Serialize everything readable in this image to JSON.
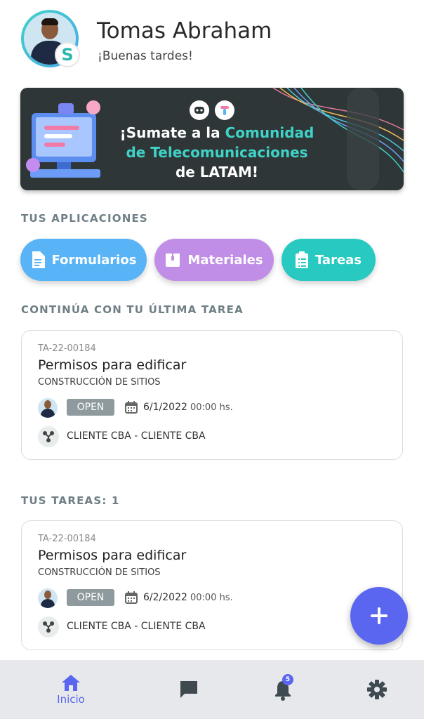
{
  "header": {
    "user_name": "Tomas Abraham",
    "greeting": "¡Buenas tardes!",
    "badge_letter": "S"
  },
  "banner": {
    "line1_white": "¡Sumate a la ",
    "line1_teal": "Comunidad",
    "line2_teal": "de Telecomunicaciones",
    "line3_white": "de LATAM!"
  },
  "apps": {
    "title": "TUS APLICACIONES",
    "items": [
      {
        "label": "Formularios",
        "icon": "document-icon",
        "color": "#58b4f7"
      },
      {
        "label": "Materiales",
        "icon": "box-icon",
        "color": "#c08ee6"
      },
      {
        "label": "Tareas",
        "icon": "clipboard-icon",
        "color": "#27c9c0"
      }
    ]
  },
  "last_task": {
    "title": "CONTINÚA CON TU ÚLTIMA TAREA",
    "card": {
      "code": "TA-22-00184",
      "name": "Permisos para edificar",
      "category": "CONSTRUCCIÓN DE SITIOS",
      "status": "OPEN",
      "date": "6/1/2022",
      "time": "00:00 hs.",
      "client": "CLIENTE CBA - CLIENTE CBA"
    }
  },
  "my_tasks": {
    "title": "TUS TAREAS:",
    "count": "1",
    "cards": [
      {
        "code": "TA-22-00184",
        "name": "Permisos para edificar",
        "category": "CONSTRUCCIÓN DE SITIOS",
        "status": "OPEN",
        "date": "6/2/2022",
        "time": "00:00 hs.",
        "client": "CLIENTE CBA - CLIENTE CBA"
      }
    ]
  },
  "fab": {
    "icon": "plus-icon"
  },
  "nav": {
    "home_label": "Inicio",
    "notifications_count": "5",
    "accent": "#5b66f0"
  }
}
